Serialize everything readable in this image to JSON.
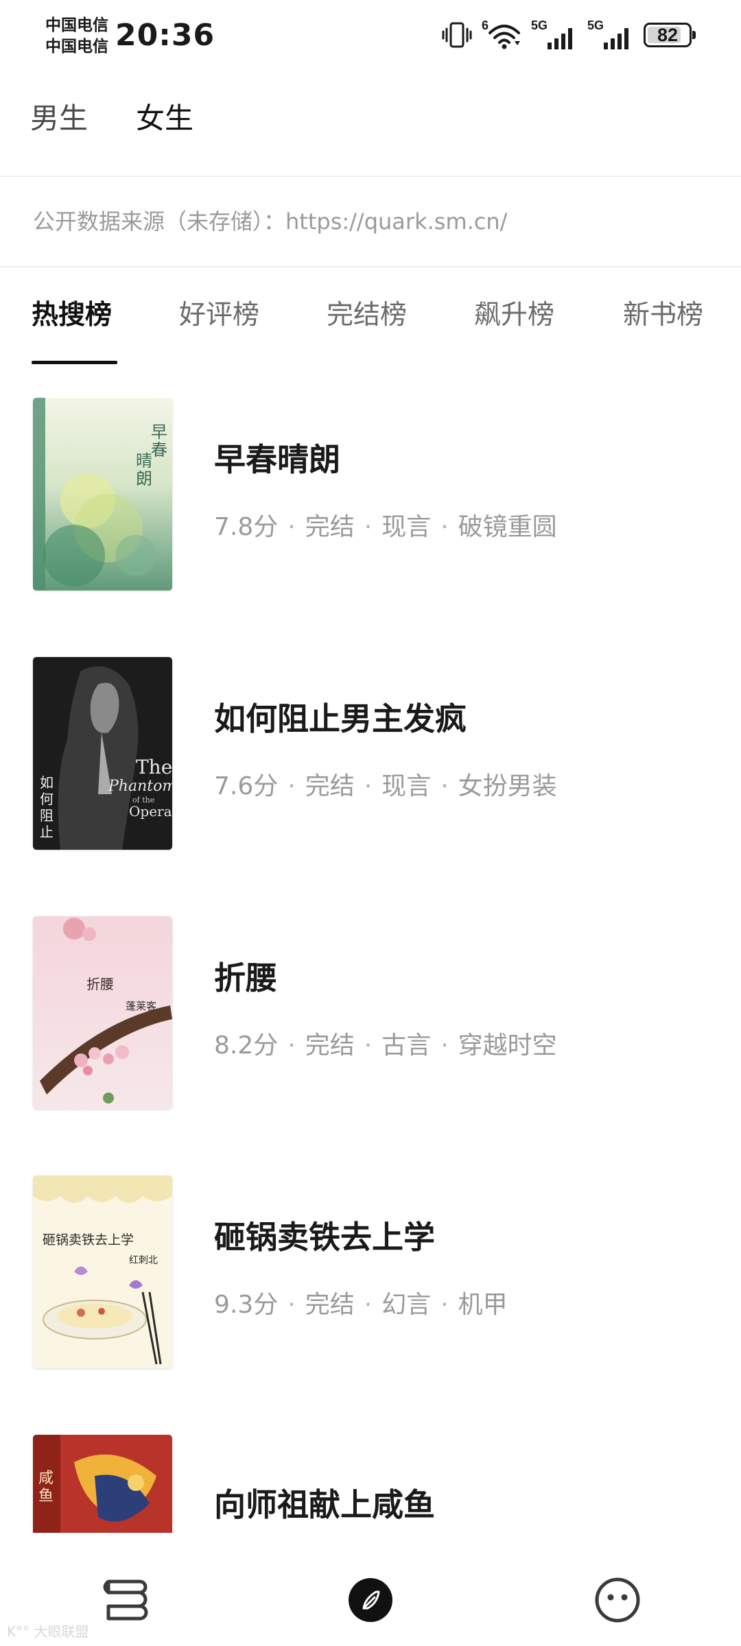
{
  "status_bar": {
    "carrier_1": "中国电信",
    "carrier_2": "中国电信",
    "time": "20:36",
    "sim1_tag": "5G",
    "sim2_tag": "5G",
    "wifi_tag": "6",
    "battery_level": "82",
    "battery_fraction": 0.82
  },
  "gender_tabs": [
    {
      "label": "男生",
      "active": false
    },
    {
      "label": "女生",
      "active": true
    }
  ],
  "source_note": "公开数据来源（未存储）：https://quark.sm.cn/",
  "rank_tabs": [
    {
      "label": "热搜榜",
      "active": true
    },
    {
      "label": "好评榜",
      "active": false
    },
    {
      "label": "完结榜",
      "active": false
    },
    {
      "label": "飙升榜",
      "active": false
    },
    {
      "label": "新书榜",
      "active": false
    }
  ],
  "books": [
    {
      "title": "早春晴朗",
      "score": "7.8分",
      "status": "完结",
      "category": "现言",
      "tag": "破镜重圆",
      "cover_text": "早春晴朗"
    },
    {
      "title": "如何阻止男主发疯",
      "score": "7.6分",
      "status": "完结",
      "category": "现言",
      "tag": "女扮男装",
      "cover_text": "如何阻止男主发疯",
      "cover_text_en_1": "The",
      "cover_text_en_2": "Phantom",
      "cover_text_en_3": "of the",
      "cover_text_en_4": "Opera"
    },
    {
      "title": "折腰",
      "score": "8.2分",
      "status": "完结",
      "category": "古言",
      "tag": "穿越时空",
      "cover_text": "折腰",
      "cover_author": "蓬莱客"
    },
    {
      "title": "砸锅卖铁去上学",
      "score": "9.3分",
      "status": "完结",
      "category": "幻言",
      "tag": "机甲",
      "cover_text": "砸锅卖铁去上学",
      "cover_author": "红刺北"
    },
    {
      "title": "向师祖献上咸鱼",
      "score": "",
      "status": "",
      "category": "",
      "tag": "",
      "cover_text": "咸鱼"
    }
  ],
  "bottom_nav": [
    {
      "icon": "bookshelf-icon",
      "active": false
    },
    {
      "icon": "compass-icon",
      "active": true
    },
    {
      "icon": "profile-face-icon",
      "active": false
    }
  ],
  "watermark": "大眼联盟",
  "colors": {
    "text_primary": "#1a1a1a",
    "text_secondary": "#9a9a9a",
    "tab_inactive": "#6a6a6a",
    "accent": "#111111"
  }
}
